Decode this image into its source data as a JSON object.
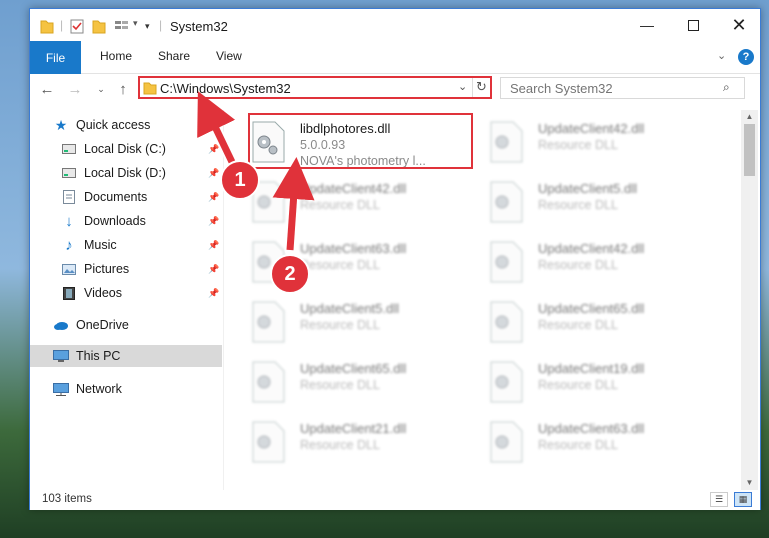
{
  "window": {
    "title": "System32"
  },
  "ribbon": {
    "file": "File",
    "home": "Home",
    "share": "Share",
    "view": "View"
  },
  "address": {
    "path": "C:\\Windows\\System32"
  },
  "search": {
    "placeholder": "Search System32"
  },
  "sidebar": {
    "items": [
      {
        "label": "Quick access",
        "icon": "star-icon"
      },
      {
        "label": "Local Disk (C:)",
        "icon": "drive-icon"
      },
      {
        "label": "Local Disk (D:)",
        "icon": "drive-icon"
      },
      {
        "label": "Documents",
        "icon": "documents-icon"
      },
      {
        "label": "Downloads",
        "icon": "downloads-icon"
      },
      {
        "label": "Music",
        "icon": "music-icon"
      },
      {
        "label": "Pictures",
        "icon": "pictures-icon"
      },
      {
        "label": "Videos",
        "icon": "videos-icon"
      },
      {
        "label": "OneDrive",
        "icon": "cloud-icon"
      },
      {
        "label": "This PC",
        "icon": "computer-icon"
      },
      {
        "label": "Network",
        "icon": "network-icon"
      }
    ]
  },
  "files": [
    {
      "name": "libdlphotores.dll",
      "version": "5.0.0.93",
      "description": "NOVA's photometry l..."
    },
    {
      "name": "UpdateClient42.dll",
      "description": "Resource DLL"
    },
    {
      "name": "UpdateClient42.dll",
      "description": "Resource DLL"
    },
    {
      "name": "UpdateClient5.dll",
      "description": "Resource DLL"
    },
    {
      "name": "UpdateClient63.dll",
      "description": "Resource DLL"
    },
    {
      "name": "UpdateClient42.dll",
      "description": "Resource DLL"
    },
    {
      "name": "UpdateClient5.dll",
      "description": "Resource DLL"
    },
    {
      "name": "UpdateClient65.dll",
      "description": "Resource DLL"
    },
    {
      "name": "UpdateClient65.dll",
      "description": "Resource DLL"
    },
    {
      "name": "UpdateClient19.dll",
      "description": "Resource DLL"
    },
    {
      "name": "UpdateClient21.dll",
      "description": "Resource DLL"
    },
    {
      "name": "UpdateClient63.dll",
      "description": "Resource DLL"
    }
  ],
  "status": {
    "count": "103 items"
  },
  "annotations": {
    "step1": "1",
    "step2": "2"
  },
  "colors": {
    "accent": "#1979ca",
    "highlight": "#e0323a"
  }
}
